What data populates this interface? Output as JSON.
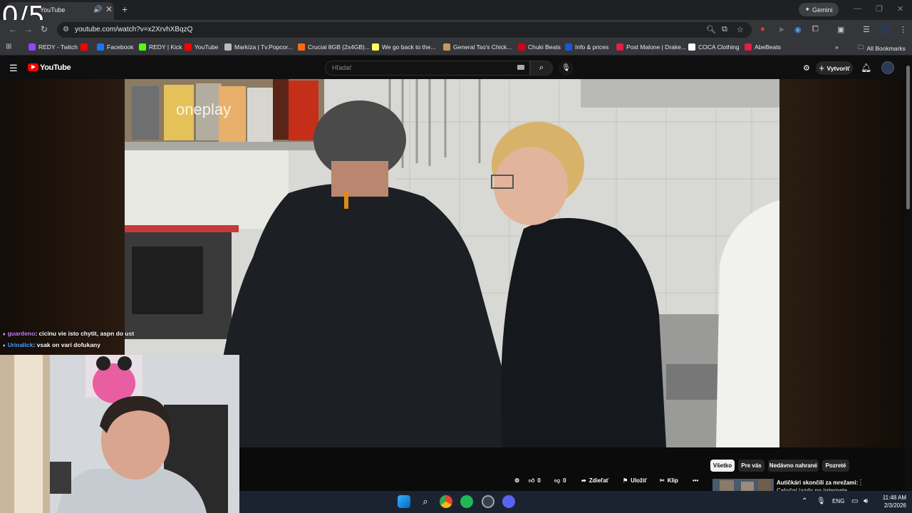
{
  "overlay": {
    "counter": "0/5"
  },
  "browser": {
    "tab_title": "YouTube",
    "url": "youtube.com/watch?v=x2XrvhXBqzQ",
    "gemini_label": "Gemini",
    "all_bookmarks": "All Bookmarks",
    "bookmarks": [
      {
        "label": "REDY - Twitch",
        "icon": "twitch-icon",
        "color": "#9146ff"
      },
      {
        "label": "",
        "icon": "youtube-icon",
        "color": "#ff0000"
      },
      {
        "label": "Facebook",
        "icon": "facebook-icon",
        "color": "#1877f2"
      },
      {
        "label": "REDY | Kick",
        "icon": "kick-icon",
        "color": "#53fc18"
      },
      {
        "label": "YouTube",
        "icon": "youtube-icon",
        "color": "#ff0000"
      },
      {
        "label": "Markíza | Tv.Popcor...",
        "icon": "markiza-icon",
        "color": "#bbbbbb"
      },
      {
        "label": "Crucial 8GB (2x4GB)...",
        "icon": "crucial-icon",
        "color": "#ff6a13"
      },
      {
        "label": "We go back to the...",
        "icon": "genius-icon",
        "color": "#ffff64"
      },
      {
        "label": "General Tso's Chick...",
        "icon": "recipe-icon",
        "color": "#c29a5b"
      },
      {
        "label": "Chuki Beats",
        "icon": "beats-icon",
        "color": "#d0021b"
      },
      {
        "label": "Info & prices",
        "icon": "b-icon",
        "color": "#1a56db"
      },
      {
        "label": "Post Malone | Drake...",
        "icon": "music-icon",
        "color": "#e11d48"
      },
      {
        "label": "COCA Clothing",
        "icon": "coca-icon",
        "color": "#ffffff"
      },
      {
        "label": "AbeBeats",
        "icon": "abebeats-icon",
        "color": "#e11d48"
      }
    ]
  },
  "youtube": {
    "logo_text": "YouTube",
    "search_placeholder": "Hľadať",
    "create_label": "Vytvoriť",
    "video_watermark": "oneplay"
  },
  "chat": [
    {
      "user": "guardeno",
      "message": ": cicinu vie isto chytit, aspn do ust"
    },
    {
      "user": "Urinalick",
      "message": ": vsak on vari dofukany"
    }
  ],
  "actions": {
    "like_count": "0",
    "dislike_count": "0",
    "share": "Zdieľať",
    "save": "Uložiť",
    "clip": "Klip"
  },
  "chips": [
    "Všetko",
    "Pre vás",
    "Nedávno nahrané",
    "Pozreté"
  ],
  "recommendation": {
    "title": "Autičkári skončili za mrežami:",
    "subtitle": "Celoční jazdy po internete"
  },
  "taskbar": {
    "lang": "ENG",
    "time": "11:48 AM",
    "date": "2/3/2026"
  }
}
